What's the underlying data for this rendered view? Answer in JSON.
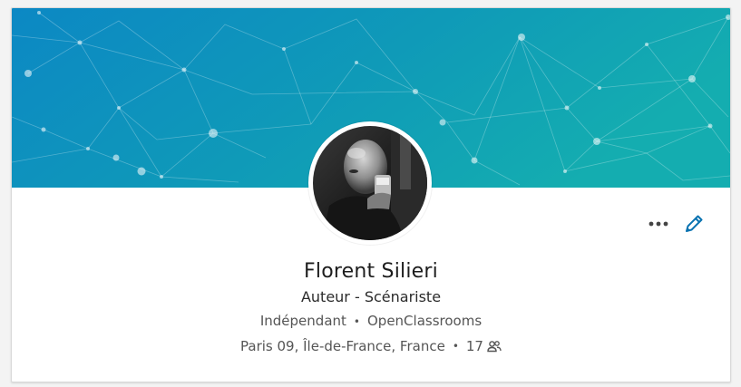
{
  "profile": {
    "name": "Florent Silieri",
    "headline": "Auteur - Scénariste",
    "company": "Indépendant",
    "school": "OpenClassrooms",
    "location": "Paris 09, Île-de-France, France",
    "connections": "17",
    "separator": "•"
  },
  "actions": {
    "more_icon": "more-horizontal-icon",
    "edit_icon": "pencil-icon"
  },
  "colors": {
    "banner_start": "#0b8bc3",
    "banner_end": "#12a8b4",
    "edit_accent": "#0a73b1"
  }
}
